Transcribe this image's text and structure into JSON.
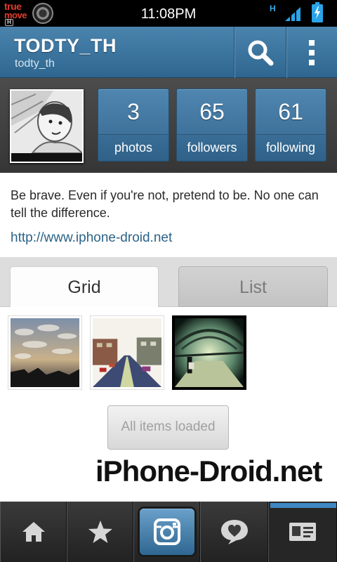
{
  "status_bar": {
    "carrier_line1": "true",
    "carrier_line2": "move",
    "carrier_badge": "H",
    "time": "11:08PM",
    "network_type": "H",
    "icons": [
      "sync-icon",
      "signal-icon",
      "battery-icon"
    ]
  },
  "header": {
    "title": "TODTY_TH",
    "username": "todty_th",
    "icons": [
      "search-icon",
      "overflow-menu-icon"
    ]
  },
  "stats": [
    {
      "value": "3",
      "label": "photos"
    },
    {
      "value": "65",
      "label": "followers"
    },
    {
      "value": "61",
      "label": "following"
    }
  ],
  "bio": {
    "text": "Be brave. Even if you're not, pretend to be. No one can tell the difference.",
    "link": "http://www.iphone-droid.net"
  },
  "tabs": [
    {
      "label": "Grid",
      "active": true
    },
    {
      "label": "List",
      "active": false
    }
  ],
  "load_button": {
    "label": "All items loaded"
  },
  "watermark": "iPhone-Droid.net",
  "bottom_nav": {
    "items": [
      "home-icon",
      "star-icon",
      "camera-icon",
      "heart-speech-icon",
      "profile-card-icon"
    ],
    "active": "profile-card-icon"
  },
  "colors": {
    "header_blue": "#3a76a1",
    "stat_blue": "#4279a3",
    "link": "#2c6388",
    "nav_active": "#3f87c2"
  }
}
